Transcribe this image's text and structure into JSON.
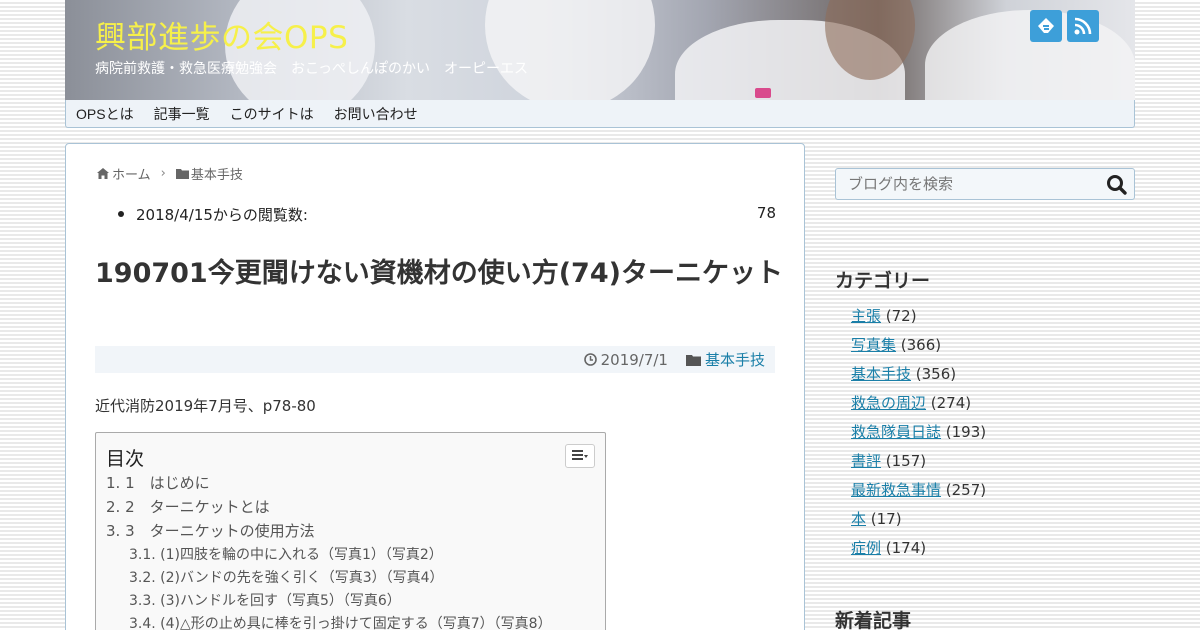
{
  "site": {
    "title": "興部進歩の会OPS",
    "subtitle": "病院前救護・救急医療勉強会　おこっぺしんぽのかい　オーピーエス"
  },
  "nav": {
    "items": [
      "OPSとは",
      "記事一覧",
      "このサイトは",
      "お問い合わせ"
    ]
  },
  "breadcrumb": {
    "home": "ホーム",
    "category": "基本手技"
  },
  "views": {
    "label": "2018/4/15からの閲覧数:",
    "count": "78"
  },
  "post": {
    "title": "190701今更聞けない資機材の使い方(74)ターニケット",
    "date": "2019/7/1",
    "category": "基本手技",
    "lead": "近代消防2019年7月号、p78-80"
  },
  "toc": {
    "title": "目次",
    "items": [
      "1. 1　はじめに",
      "2. 2　ターニケットとは",
      "3. 3　ターニケットの使用方法",
      "3.1. (1)四肢を輪の中に入れる（写真1）（写真2）",
      "3.2. (2)バンドの先を強く引く（写真3）（写真4）",
      "3.3. (3)ハンドルを回す（写真5）（写真6）",
      "3.4. (4)△形の止め具に棒を引っ掛けて固定する（写真7）（写真8）"
    ]
  },
  "sidebar": {
    "search_placeholder": "ブログ内を検索",
    "categories_heading": "カテゴリー",
    "categories": [
      {
        "name": "主張",
        "count": " (72)"
      },
      {
        "name": "写真集",
        "count": " (366)"
      },
      {
        "name": "基本手技",
        "count": " (356)"
      },
      {
        "name": "救急の周辺",
        "count": " (274)"
      },
      {
        "name": "救急隊員日誌",
        "count": " (193)"
      },
      {
        "name": "書評",
        "count": " (157)"
      },
      {
        "name": "最新救急事情",
        "count": " (257)"
      },
      {
        "name": "本",
        "count": " (17)"
      },
      {
        "name": "症例",
        "count": " (174)"
      }
    ],
    "recent_heading": "新着記事"
  },
  "icons": {
    "feedly": "feedly-icon",
    "rss": "rss-icon",
    "home": "home-icon",
    "folder": "folder-icon",
    "clock": "clock-icon",
    "toc_toggle": "list-icon",
    "search": "search-icon"
  },
  "colors": {
    "site_title": "#f6f04a",
    "link": "#1a7fa8",
    "icon_bg": "#3d9fd9",
    "border": "#a9c3d6"
  }
}
